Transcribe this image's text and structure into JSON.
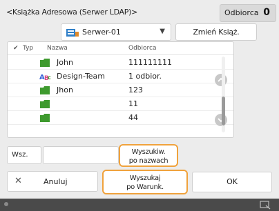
{
  "header": {
    "title": "<Książka Adresowa (Serwer LDAP)>",
    "recipients_label": "Odbiorca",
    "recipients_count": "0"
  },
  "toolbar": {
    "server_label": "Serwer-01",
    "change_book_label": "Zmień Książ. Adresową"
  },
  "list": {
    "columns": {
      "type": "Typ",
      "name": "Nazwa",
      "destination": "Odbiorca"
    },
    "rows": [
      {
        "icon": "folder-icon",
        "name": "John",
        "destination": "111111111"
      },
      {
        "icon": "group-icon",
        "name": "Design-Team",
        "destination": "1 odbior."
      },
      {
        "icon": "folder-icon",
        "name": "Jhon",
        "destination": "123"
      },
      {
        "icon": "folder-icon",
        "name": "",
        "destination": "11"
      },
      {
        "icon": "folder-icon",
        "name": "",
        "destination": "44"
      }
    ]
  },
  "search": {
    "label": "Wsz.",
    "value": "",
    "name_search_line1": "Wyszukiw.",
    "name_search_line2": "po nazwach"
  },
  "footer": {
    "cancel_label": "Anuluj",
    "cond_search_line1": "Wyszukaj",
    "cond_search_line2": "po Warunk.",
    "ok_label": "OK"
  },
  "colors": {
    "accent_border": "#f0a23c",
    "folder_icon": "#3e9a2e",
    "server_icon": "#2f7fc8",
    "status_bar": "#4a4a4a"
  }
}
